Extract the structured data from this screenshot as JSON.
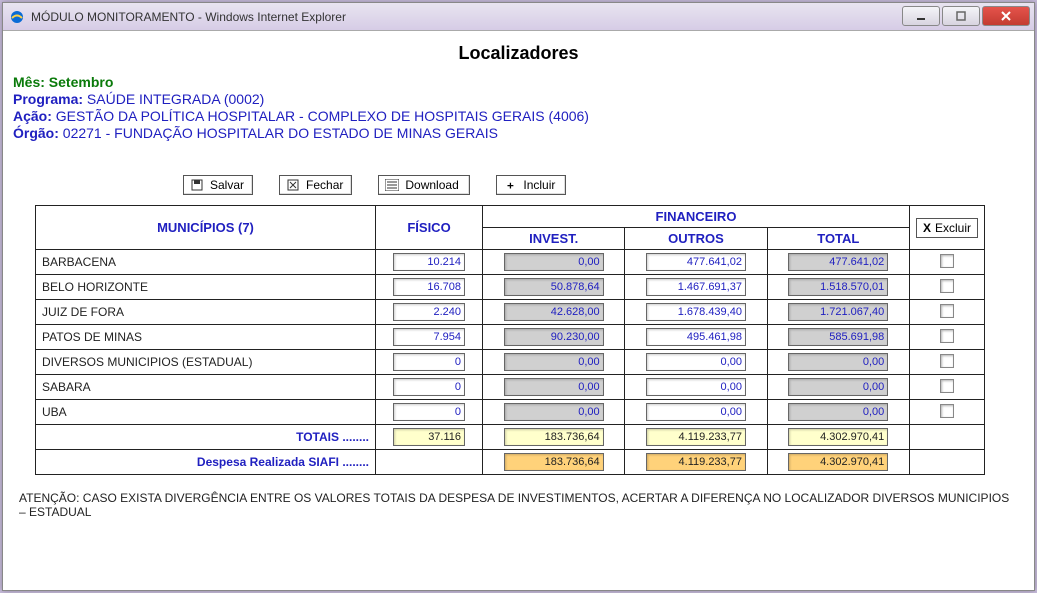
{
  "window": {
    "title": "MÓDULO MONITORAMENTO - Windows Internet Explorer"
  },
  "page": {
    "title": "Localizadores"
  },
  "meta": {
    "mes_label": "Mês:",
    "mes_value": "Setembro",
    "programa_label": "Programa:",
    "programa_value": "SAÚDE INTEGRADA (0002)",
    "acao_label": "Ação:",
    "acao_value": "GESTÃO DA POLÍTICA HOSPITALAR - COMPLEXO DE HOSPITAIS GERAIS (4006)",
    "orgao_label": "Órgão:",
    "orgao_value": "02271 - FUNDAÇÃO HOSPITALAR DO ESTADO DE MINAS GERAIS"
  },
  "toolbar": {
    "salvar": "Salvar",
    "fechar": "Fechar",
    "download": "Download",
    "incluir": "Incluir",
    "excluir": "Excluir"
  },
  "headers": {
    "municipios": "MUNICÍPIOS (7)",
    "fisico": "FÍSICO",
    "financeiro": "FINANCEIRO",
    "invest": "INVEST.",
    "outros": "OUTROS",
    "total": "TOTAL"
  },
  "rows": [
    {
      "name": "BARBACENA",
      "fisico": "10.214",
      "invest": "0,00",
      "outros": "477.641,02",
      "total": "477.641,02"
    },
    {
      "name": "BELO HORIZONTE",
      "fisico": "16.708",
      "invest": "50.878,64",
      "outros": "1.467.691,37",
      "total": "1.518.570,01"
    },
    {
      "name": "JUIZ DE FORA",
      "fisico": "2.240",
      "invest": "42.628,00",
      "outros": "1.678.439,40",
      "total": "1.721.067,40"
    },
    {
      "name": "PATOS DE MINAS",
      "fisico": "7.954",
      "invest": "90.230,00",
      "outros": "495.461,98",
      "total": "585.691,98"
    },
    {
      "name": "DIVERSOS MUNICIPIOS (ESTADUAL)",
      "fisico": "0",
      "invest": "0,00",
      "outros": "0,00",
      "total": "0,00"
    },
    {
      "name": "SABARA",
      "fisico": "0",
      "invest": "0,00",
      "outros": "0,00",
      "total": "0,00"
    },
    {
      "name": "UBA",
      "fisico": "0",
      "invest": "0,00",
      "outros": "0,00",
      "total": "0,00"
    }
  ],
  "totais": {
    "label": "TOTAIS ........",
    "fisico": "37.116",
    "invest": "183.736,64",
    "outros": "4.119.233,77",
    "total": "4.302.970,41"
  },
  "siafi": {
    "label": "Despesa Realizada SIAFI ........",
    "invest": "183.736,64",
    "outros": "4.119.233,77",
    "total": "4.302.970,41"
  },
  "footer_note": "ATENÇÃO: CASO EXISTA DIVERGÊNCIA ENTRE OS VALORES TOTAIS DA DESPESA DE INVESTIMENTOS, ACERTAR A DIFERENÇA NO LOCALIZADOR DIVERSOS MUNICIPIOS – ESTADUAL"
}
